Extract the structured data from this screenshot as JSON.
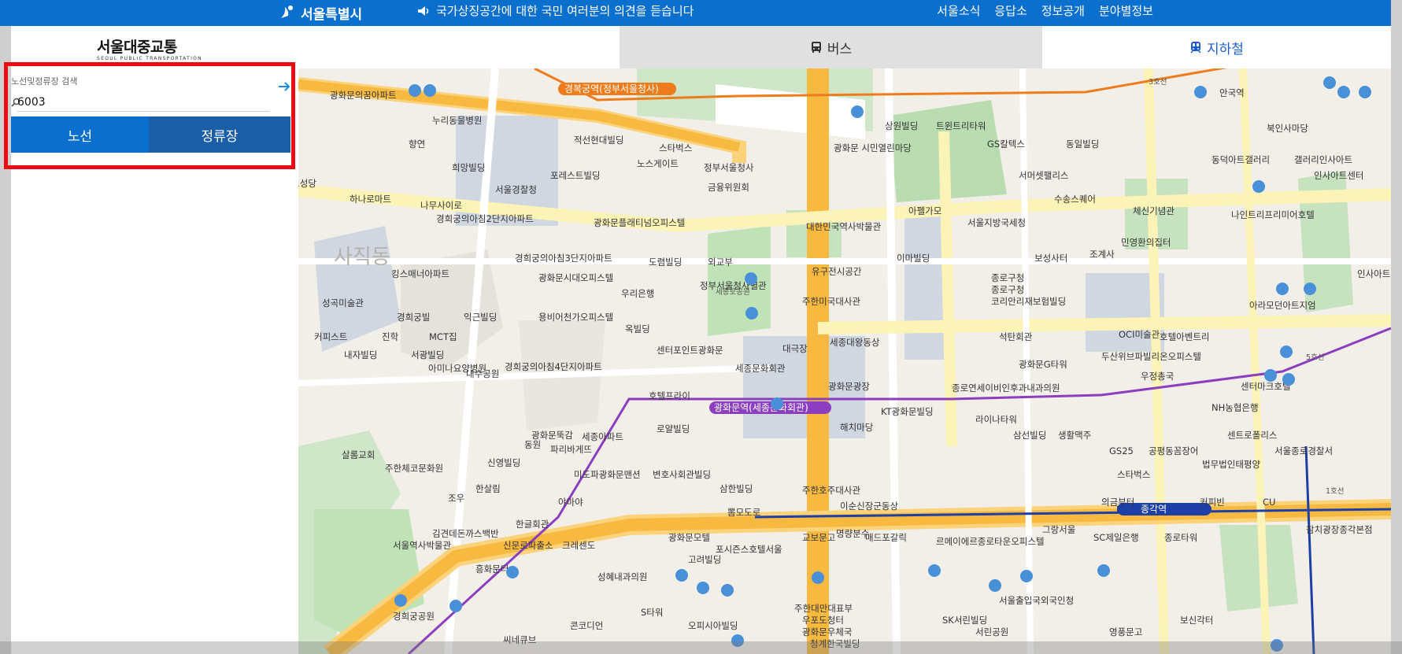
{
  "topbar": {
    "seoul_label": "서울특별시",
    "notice": "국가상징공간에 대한 국민 여러분의 의견을 듣습니다",
    "links": [
      "서울소식",
      "응답소",
      "정보공개",
      "분야별정보"
    ]
  },
  "brand": {
    "name": "서울대중교통",
    "name_en": "SEOUL PUBLIC TRANSPORTATION"
  },
  "tabs": {
    "bus": "버스",
    "subway": "지하철"
  },
  "search": {
    "label": "노선및정류장 검색",
    "value": "6003",
    "route_button": "노선",
    "stop_button": "정류장"
  },
  "map": {
    "labels": [
      "경복궁역(정부서울청사)",
      "광화문역(세종문화회관)",
      "종각역",
      "종로구청",
      "광화문 시민열린마당",
      "세종로공원",
      "세종문화회관",
      "광화문광장",
      "서울경찰청",
      "사직동",
      "누리동물병원",
      "광화문의꿈아파트",
      "적선현대빌딩",
      "스타벅스",
      "노스게이트",
      "정부서울청사",
      "금융위원회",
      "상원빌딩",
      "트윈트리타워",
      "GS칼텍스",
      "동일빌딩",
      "안국역",
      "북인사마당",
      "서머셋팰리스",
      "수송스퀘어",
      "아펠가모",
      "서울지방국세청",
      "체신기념관",
      "대한민국역사박물관",
      "주한미국대사관",
      "이마빌딩",
      "조계사",
      "민영환의집터",
      "보성사터",
      "코리안리재보험빌딩",
      "석탄회관",
      "종로연세이비인후과내과의원",
      "광화문G타워",
      "두산위브파빌리온오피스텔",
      "라이나타워",
      "삼선빌딩",
      "생활맥주",
      "GS25",
      "공평동꼼장어",
      "서울종로경찰서",
      "의금부터",
      "그랑서울",
      "SC제일은행",
      "종로타워",
      "보신각터",
      "영풍문고",
      "서울출입국외국인청",
      "KT광화문빌딩",
      "주한호주대사관",
      "교보문고",
      "매드포갈릭",
      "르메이에르종로타운오피스텔",
      "SK서린빌딩",
      "서린공원",
      "청계한국빌딩",
      "우포도청터",
      "광화문우체국",
      "세종아파트",
      "신영빌딩",
      "미도파광화문맨션",
      "변호사회관빌딩",
      "삼한빌딩",
      "뽐모도로",
      "광화문모텔",
      "포시즌스호텔서울",
      "고려빌딩",
      "성혜내과의원",
      "주한대만대표부",
      "오피시아빌딩",
      "S타워",
      "콘코디언",
      "씨네큐브",
      "흥화문터",
      "경희궁공원",
      "서울역사박물관",
      "김견데돈까스백반",
      "신문로파출소",
      "크레센도",
      "야마야",
      "한글회관",
      "한살림",
      "조우",
      "주한체코문화원",
      "살롬교회",
      "경희궁의아침3단지아파트",
      "경희궁의아침4단지아파트",
      "경희궁의아침2단지아파트",
      "킹스매너아파트",
      "성곡미술관",
      "경희궁빌",
      "익근빌딩",
      "커피스트",
      "진학",
      "MCT집",
      "내자빌딩",
      "서광빌딩",
      "아미나요양병원",
      "내수공원",
      "광화문뚝감",
      "파리바게뜨",
      "동원",
      "로얄빌딩",
      "호텔프라이",
      "센터포인트광화문",
      "옥빌딩",
      "용비어천가오피스텔",
      "광화문시대오피스텔",
      "우리은행",
      "도렴빌딩",
      "외교부",
      "정부서울청사별관",
      "광화문플래티넘오피스텔",
      "나무사이로",
      "하나로마트",
      "세종로성당",
      "향연",
      "희망빌딩",
      "포레스트빌딩",
      "대극장",
      "유구전시공간",
      "이순신장군동상",
      "명량분수",
      "해치마당",
      "세종대왕동상",
      "스타벅스",
      "OCI미술관",
      "호텔아벤트리",
      "센터마크호텔",
      "NH농협은행",
      "센트로폴리스",
      "법무법인태평양",
      "커피빈",
      "CU",
      "참치광장종각본점",
      "인사아트센터",
      "나인트리프리미어호텔",
      "갤러리인사아트",
      "동덕아트갤러리",
      "아라모던아트지엄",
      "인사아트센",
      "우정총국",
      "종로구청"
    ],
    "lines": [
      "3호선",
      "5호선",
      "1호선"
    ]
  },
  "colors": {
    "topbar": "#0b6fce",
    "route_button": "#0b6fce",
    "stop_button": "#1a5fa8",
    "highlight": "#ee0a12",
    "subway_tab_text": "#1a5ccf",
    "line3": "#ef7c1c",
    "line5": "#8b3fbf",
    "line1": "#1e3fa6"
  }
}
